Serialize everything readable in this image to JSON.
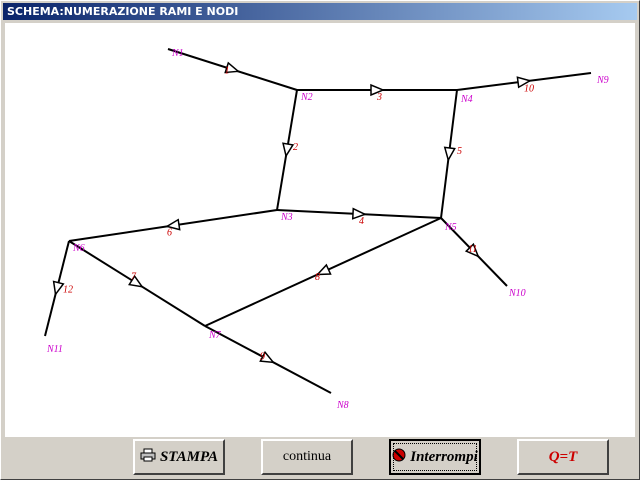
{
  "window": {
    "title": "SCHEMA:NUMERAZIONE RAMI E NODI"
  },
  "colors": {
    "branch": "#cc0000",
    "node": "#cc00cc",
    "titlebar": "#0a246a"
  },
  "diagram": {
    "nodes": [
      {
        "id": "N1",
        "label": "N1"
      },
      {
        "id": "N2",
        "label": "N2"
      },
      {
        "id": "N3",
        "label": "N3"
      },
      {
        "id": "N4",
        "label": "N4"
      },
      {
        "id": "N5",
        "label": "N5"
      },
      {
        "id": "N6",
        "label": "N6"
      },
      {
        "id": "N7",
        "label": "N7"
      },
      {
        "id": "N8",
        "label": "N8"
      },
      {
        "id": "N9",
        "label": "N9"
      },
      {
        "id": "N10",
        "label": "N10"
      },
      {
        "id": "N11",
        "label": "N11"
      }
    ],
    "branches": [
      {
        "label": "1",
        "from": "N1",
        "to": "N2"
      },
      {
        "label": "2",
        "from": "N2",
        "to": "N3"
      },
      {
        "label": "3",
        "from": "N2",
        "to": "N4"
      },
      {
        "label": "4",
        "from": "N3",
        "to": "N5"
      },
      {
        "label": "5",
        "from": "N4",
        "to": "N5"
      },
      {
        "label": "6",
        "from": "N3",
        "to": "N6"
      },
      {
        "label": "7",
        "from": "N6",
        "to": "N7"
      },
      {
        "label": "8",
        "from": "N5",
        "to": "N7"
      },
      {
        "label": "9",
        "from": "N7",
        "to": "N8"
      },
      {
        "label": "10",
        "from": "N4",
        "to": "N9"
      },
      {
        "label": "11",
        "from": "N5",
        "to": "N10"
      },
      {
        "label": "12",
        "from": "N6",
        "to": "N11"
      }
    ]
  },
  "buttons": {
    "stampa": {
      "label": "STAMPA",
      "icon": "printer-icon"
    },
    "continua": {
      "label": "continua"
    },
    "interrompi": {
      "label": "Interrompi",
      "icon": "stop-icon"
    },
    "qt": {
      "label": "Q=T"
    }
  }
}
